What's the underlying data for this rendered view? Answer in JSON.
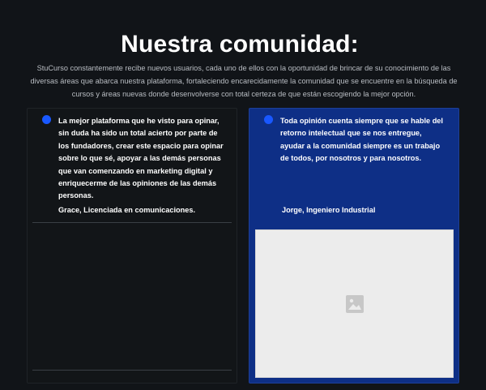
{
  "section": {
    "title": "Nuestra comunidad:",
    "intro": "StuCurso constantemente recibe nuevos usuarios, cada uno de ellos con la oportunidad de brincar de su conocimiento de las diversas áreas que abarca nuestra plataforma, fortaleciendo encarecidamente la comunidad que se encuentre en la búsqueda de cursos y áreas nuevas donde desenvolverse con total certeza de que están escogiendo la mejor opción."
  },
  "testimonials": [
    {
      "quote": "La mejor plataforma que he visto para opinar, sin duda ha sido un total acierto por parte de los fundadores, crear este espacio para opinar sobre lo que sé, apoyar a las demás personas que van comenzando en marketing digital y enriquecerme de las opiniones de las demás personas.",
      "author": "Grace, Licenciada en comunicaciones."
    },
    {
      "quote": "Toda opinión cuenta siempre que se hable del retorno intelectual que se nos entregue, ayudar a la comunidad siempre es un trabajo de todos, por nosotros y para nosotros.",
      "author": "Jorge, Ingeniero Industrial"
    }
  ],
  "colors": {
    "background": "#111418",
    "card_dark": "#121518",
    "card_accent": "#0e2f86",
    "dot": "#1958ff",
    "placeholder": "#ececec"
  },
  "icons": {
    "bullet": "dot-icon",
    "placeholder": "image-placeholder-icon"
  }
}
